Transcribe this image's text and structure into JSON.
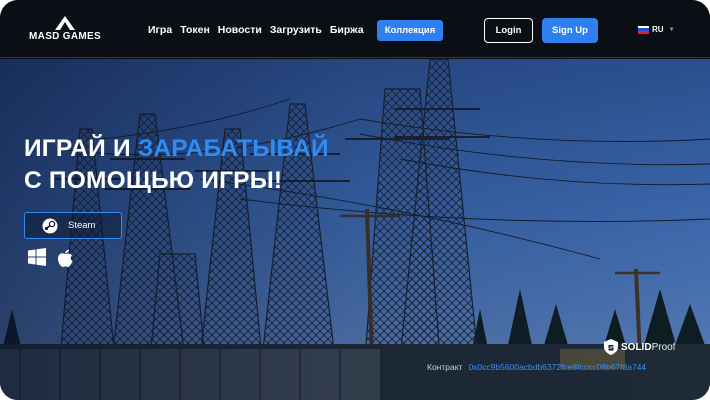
{
  "header": {
    "logo_text": "MASD GAMES",
    "nav": [
      {
        "label": "Игра"
      },
      {
        "label": "Токен"
      },
      {
        "label": "Новости"
      },
      {
        "label": "Загрузить"
      },
      {
        "label": "Биржа"
      }
    ],
    "collection_label": "Коллекция",
    "login_label": "Login",
    "signup_label": "Sign Up",
    "language": "RU"
  },
  "hero": {
    "headline_part1": "ИГРАЙ И ",
    "headline_accent": "ЗАРАБАТЫВАЙ",
    "headline_line2": "С ПОМОЩЬЮ ИГРЫ!",
    "steam_label": "Steam",
    "platform_icons": [
      "windows-icon",
      "apple-icon"
    ],
    "audit_brand_bold": "SOLID",
    "audit_brand_light": "Proof",
    "contract_label": "Контракт",
    "contract_address": "0x0cc9b5600acbdb6372fce8fcccc08b67f8a744"
  },
  "colors": {
    "accent": "#2e7ff0",
    "header_bg": "#0b0e14",
    "headline_accent": "#2e8cf5"
  }
}
